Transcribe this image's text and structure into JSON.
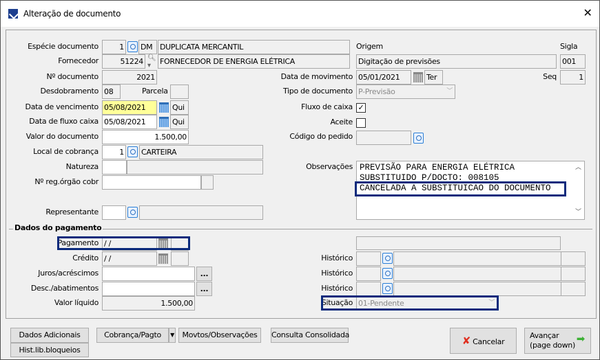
{
  "window": {
    "title": "Alteração de documento",
    "close": "✕"
  },
  "left": {
    "especie": {
      "label": "Espécie documento",
      "code": "1",
      "sigla": "DM",
      "desc": "DUPLICATA MERCANTIL"
    },
    "fornecedor": {
      "label": "Fornecedor",
      "code": "51224",
      "desc": "FORNECEDOR DE ENERGIA ELÉTRICA"
    },
    "ndoc": {
      "label": "Nº documento",
      "value": "2021"
    },
    "desdobramento": {
      "label": "Desdobramento",
      "value": "08",
      "parcela_label": "Parcela",
      "parcela": ""
    },
    "vencimento": {
      "label": "Data de vencimento",
      "value": "05/08/2021",
      "day": "Qui"
    },
    "fluxo_data": {
      "label": "Data de fluxo caixa",
      "value": "05/08/2021",
      "day": "Qui"
    },
    "valor": {
      "label": "Valor do documento",
      "value": "1.500,00"
    },
    "local": {
      "label": "Local de cobrança",
      "code": "1",
      "desc": "CARTEIRA"
    },
    "natureza": {
      "label": "Natureza"
    },
    "nreg": {
      "label": "Nº reg.órgão cobr"
    },
    "representante": {
      "label": "Representante"
    }
  },
  "right": {
    "origem": {
      "label": "Origem",
      "value": "Digitação de previsões"
    },
    "sigla": {
      "label": "Sigla",
      "value": "001"
    },
    "movimento": {
      "label": "Data de movimento",
      "value": "05/01/2021",
      "day": "Ter"
    },
    "seq": {
      "label": "Seq",
      "value": "1"
    },
    "tipo": {
      "label": "Tipo de documento",
      "value": "P-Previsão"
    },
    "fluxo": {
      "label": "Fluxo de caixa",
      "checked": true,
      "mark": "✓"
    },
    "aceite": {
      "label": "Aceite",
      "checked": false
    },
    "pedido": {
      "label": "Código do pedido"
    },
    "obs": {
      "label": "Observações",
      "lines": [
        "PREVISÃO PARA ENERGIA ELÉTRICA",
        "SUBSTITUIDO P/DOCTO:   008105",
        "CANCELADA A SUBSTITUICAO DO DOCUMENTO"
      ]
    }
  },
  "pagamento": {
    "section": "Dados do pagamento",
    "pagamento": {
      "label": "Pagamento",
      "value": " / /"
    },
    "credito": {
      "label": "Crédito",
      "value": " / /"
    },
    "juros": {
      "label": "Juros/acréscimos",
      "btn": "..."
    },
    "desc": {
      "label": "Desc./abatimentos",
      "btn": "..."
    },
    "liquido": {
      "label": "Valor líquido",
      "value": "1.500,00"
    },
    "historico_label": "Histórico",
    "situacao": {
      "label": "Situação",
      "value": "01-Pendente"
    }
  },
  "buttons": {
    "dados": "Dados Adicionais",
    "cobranca": "Cobrança/Pagto",
    "movtos": "Movtos/Observações",
    "consulta": "Consulta Consolidada",
    "hist": "Hist.lib.bloqueios",
    "cancelar": "Cancelar",
    "avancar1": "Avançar",
    "avancar2": "(page down)"
  }
}
